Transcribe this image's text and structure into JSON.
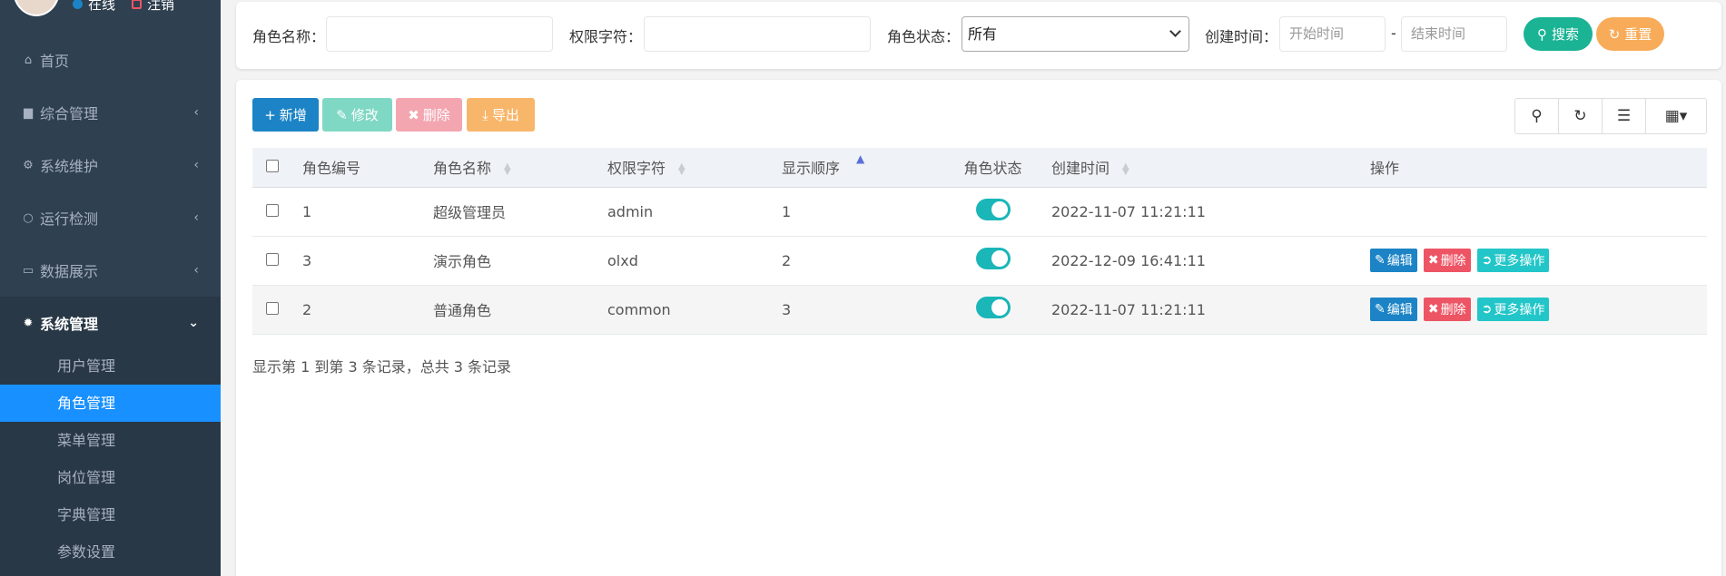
{
  "sidebar": {
    "status_online": "在线",
    "status_logout": "注销",
    "menu": [
      {
        "label": "首页",
        "icon": "home-icon"
      },
      {
        "label": "综合管理",
        "icon": "square-icon"
      },
      {
        "label": "系统维护",
        "icon": "cogs-icon"
      },
      {
        "label": "运行检测",
        "icon": "circle-icon"
      },
      {
        "label": "数据展示",
        "icon": "laptop-icon"
      },
      {
        "label": "系统管理",
        "icon": "gear-icon"
      }
    ],
    "submenu": [
      "用户管理",
      "角色管理",
      "菜单管理",
      "岗位管理",
      "字典管理",
      "参数设置"
    ],
    "active_submenu": "角色管理"
  },
  "search": {
    "role_name_label": "角色名称：",
    "perm_label": "权限字符：",
    "status_label": "角色状态：",
    "status_value": "所有",
    "time_label": "创建时间：",
    "start_placeholder": "开始时间",
    "end_placeholder": "结束时间",
    "dash": "-",
    "search_btn": "搜索",
    "reset_btn": "重置"
  },
  "toolbar": {
    "add": "新增",
    "edit": "修改",
    "delete": "删除",
    "export": "导出"
  },
  "table": {
    "headers": [
      "角色编号",
      "角色名称",
      "权限字符",
      "显示顺序",
      "角色状态",
      "创建时间",
      "操作"
    ],
    "rows": [
      {
        "id": "1",
        "name": "超级管理员",
        "key": "admin",
        "order": "1",
        "status": true,
        "created": "2022-11-07 11:21:11",
        "actions": false
      },
      {
        "id": "3",
        "name": "演示角色",
        "key": "olxd",
        "order": "2",
        "status": true,
        "created": "2022-12-09 16:41:11",
        "actions": true
      },
      {
        "id": "2",
        "name": "普通角色",
        "key": "common",
        "order": "3",
        "status": true,
        "created": "2022-11-07 11:21:11",
        "actions": true
      }
    ],
    "op_edit": "编辑",
    "op_delete": "删除",
    "op_more": "更多操作"
  },
  "footer": "显示第 1 到第 3 条记录，总共 3 条记录",
  "colors": {
    "sidebar_bg": "#2f4050",
    "active_blue": "#1890ff",
    "primary": "#1c84c6",
    "success": "#1ab394",
    "warning": "#f8ac59",
    "danger": "#ed5565",
    "info": "#23c6c8"
  }
}
